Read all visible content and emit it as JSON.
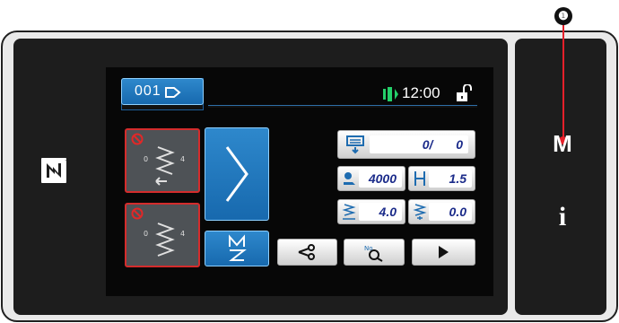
{
  "callout": {
    "number": "❶"
  },
  "side_keys": {
    "menu_key": "M",
    "info_key": "i"
  },
  "screen": {
    "pattern_number": "001",
    "time": "12:00",
    "counter": {
      "current": "0/",
      "target": "0"
    },
    "max_speed": "4000",
    "stitch_length": "1.5",
    "zigzag_width": "4.0",
    "zigzag_position": "0.0"
  },
  "icons": [
    "nfc-icon",
    "clock-antenna-icon",
    "lock-icon",
    "counter-icon",
    "speed-icon",
    "stitch-length-icon",
    "zigzag-width-icon",
    "zigzag-position-icon",
    "zigzag-pattern-icon",
    "stitch-type-icon",
    "thread-trim-icon",
    "pattern-search-icon",
    "play-icon",
    "prohibit-icon"
  ],
  "colors": {
    "screen_bg": "#070707",
    "button_blue": "#1f78bf",
    "border_red": "#d42c2c",
    "accent_green": "#24d06a",
    "callout_red": "#e5202a"
  }
}
